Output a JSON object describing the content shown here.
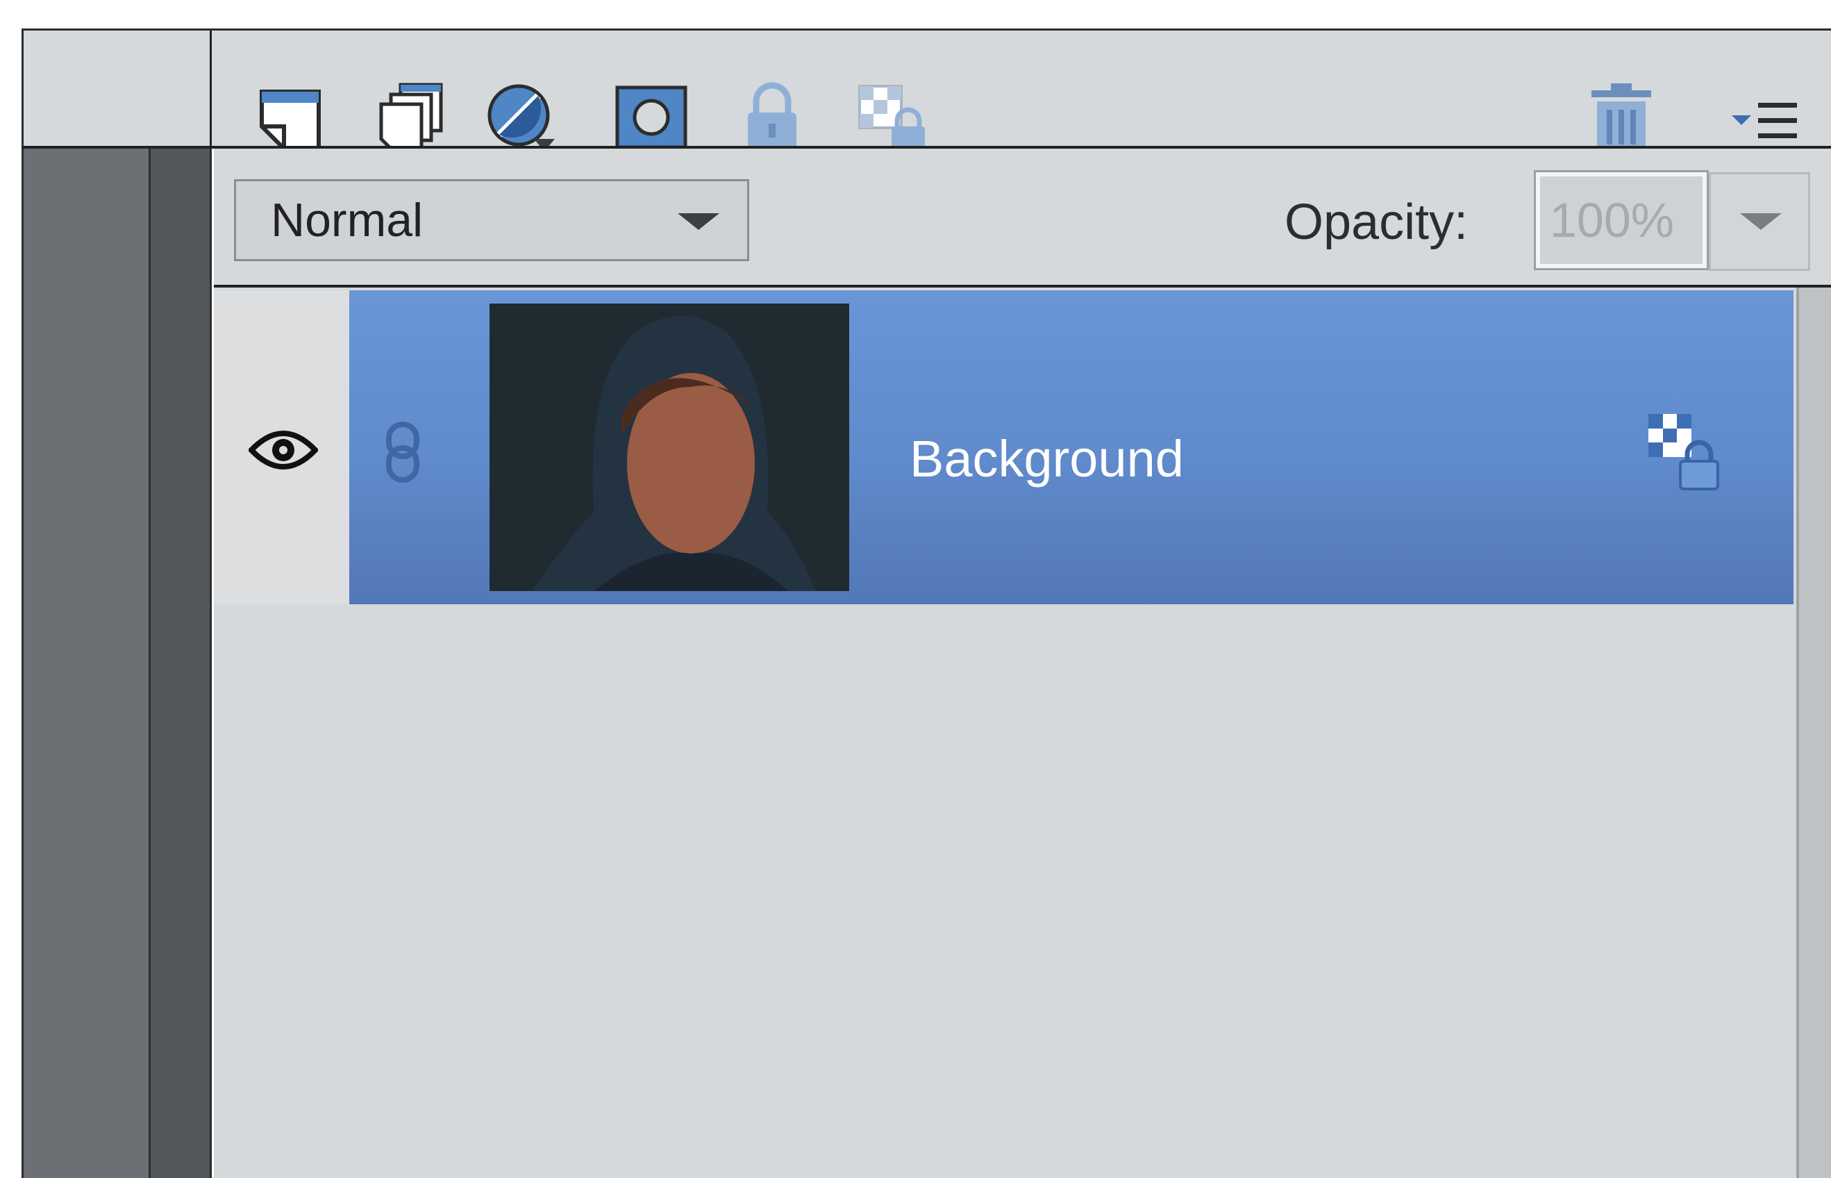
{
  "toolbar": {
    "tools": [
      {
        "name": "new-layer-icon"
      },
      {
        "name": "new-group-icon"
      },
      {
        "name": "adjustment-layer-icon"
      },
      {
        "name": "layer-mask-icon"
      },
      {
        "name": "lock-all-icon"
      },
      {
        "name": "lock-transparency-icon"
      }
    ],
    "right_tools": [
      {
        "name": "trash-icon"
      },
      {
        "name": "panel-menu-icon"
      }
    ]
  },
  "blend": {
    "mode": "Normal",
    "opacity_label": "Opacity:",
    "opacity_value": "100%"
  },
  "layers": [
    {
      "name": "Background",
      "visible": true,
      "selected": true,
      "locked": true
    }
  ],
  "colors": {
    "panel_bg": "#d6d9db",
    "selection": "#6391d2",
    "accent_icon": "#4f86c6"
  }
}
